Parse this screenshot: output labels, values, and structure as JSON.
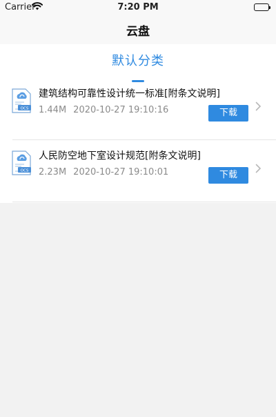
{
  "status_bar": {
    "carrier": "Carrier",
    "time": "7:20 PM"
  },
  "nav": {
    "title": "云盘"
  },
  "category": {
    "label": "默认分类"
  },
  "files": [
    {
      "name": "建筑结构可靠性设计统一标准[附条文说明]",
      "size": "1.44M",
      "date": "2020-10-27 19:10:16",
      "download_label": "下载",
      "icon": "ocs-document-icon",
      "icon_badge": "OCS"
    },
    {
      "name": "人民防空地下室设计规范[附条文说明]",
      "size": "2.23M",
      "date": "2020-10-27 19:10:01",
      "download_label": "下载",
      "icon": "ocs-document-icon",
      "icon_badge": "OCS"
    }
  ],
  "colors": {
    "accent": "#2f8ae0",
    "background": "#f2f2f2"
  }
}
